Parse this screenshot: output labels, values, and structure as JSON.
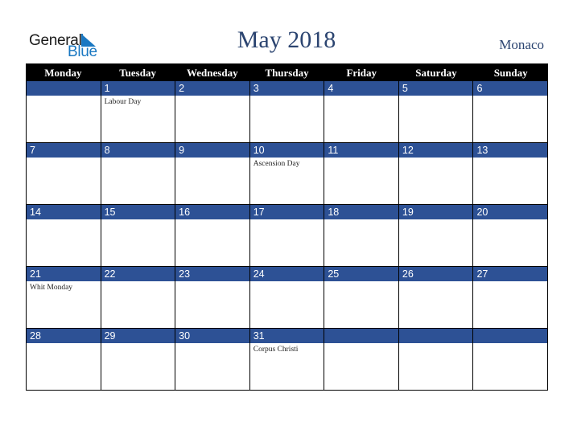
{
  "logo": {
    "line1": "General",
    "line2": "Blue",
    "brand_color": "#1a78c2"
  },
  "title": "May 2018",
  "country": "Monaco",
  "colors": {
    "header_bg": "#000000",
    "day_bar": "#2d5195",
    "title": "#2b4470"
  },
  "weekdays": [
    "Monday",
    "Tuesday",
    "Wednesday",
    "Thursday",
    "Friday",
    "Saturday",
    "Sunday"
  ],
  "weeks": [
    [
      {
        "day": "",
        "holiday": ""
      },
      {
        "day": "1",
        "holiday": "Labour Day"
      },
      {
        "day": "2",
        "holiday": ""
      },
      {
        "day": "3",
        "holiday": ""
      },
      {
        "day": "4",
        "holiday": ""
      },
      {
        "day": "5",
        "holiday": ""
      },
      {
        "day": "6",
        "holiday": ""
      }
    ],
    [
      {
        "day": "7",
        "holiday": ""
      },
      {
        "day": "8",
        "holiday": ""
      },
      {
        "day": "9",
        "holiday": ""
      },
      {
        "day": "10",
        "holiday": "Ascension Day"
      },
      {
        "day": "11",
        "holiday": ""
      },
      {
        "day": "12",
        "holiday": ""
      },
      {
        "day": "13",
        "holiday": ""
      }
    ],
    [
      {
        "day": "14",
        "holiday": ""
      },
      {
        "day": "15",
        "holiday": ""
      },
      {
        "day": "16",
        "holiday": ""
      },
      {
        "day": "17",
        "holiday": ""
      },
      {
        "day": "18",
        "holiday": ""
      },
      {
        "day": "19",
        "holiday": ""
      },
      {
        "day": "20",
        "holiday": ""
      }
    ],
    [
      {
        "day": "21",
        "holiday": "Whit Monday"
      },
      {
        "day": "22",
        "holiday": ""
      },
      {
        "day": "23",
        "holiday": ""
      },
      {
        "day": "24",
        "holiday": ""
      },
      {
        "day": "25",
        "holiday": ""
      },
      {
        "day": "26",
        "holiday": ""
      },
      {
        "day": "27",
        "holiday": ""
      }
    ],
    [
      {
        "day": "28",
        "holiday": ""
      },
      {
        "day": "29",
        "holiday": ""
      },
      {
        "day": "30",
        "holiday": ""
      },
      {
        "day": "31",
        "holiday": "Corpus Christi"
      },
      {
        "day": "",
        "holiday": ""
      },
      {
        "day": "",
        "holiday": ""
      },
      {
        "day": "",
        "holiday": ""
      }
    ]
  ]
}
